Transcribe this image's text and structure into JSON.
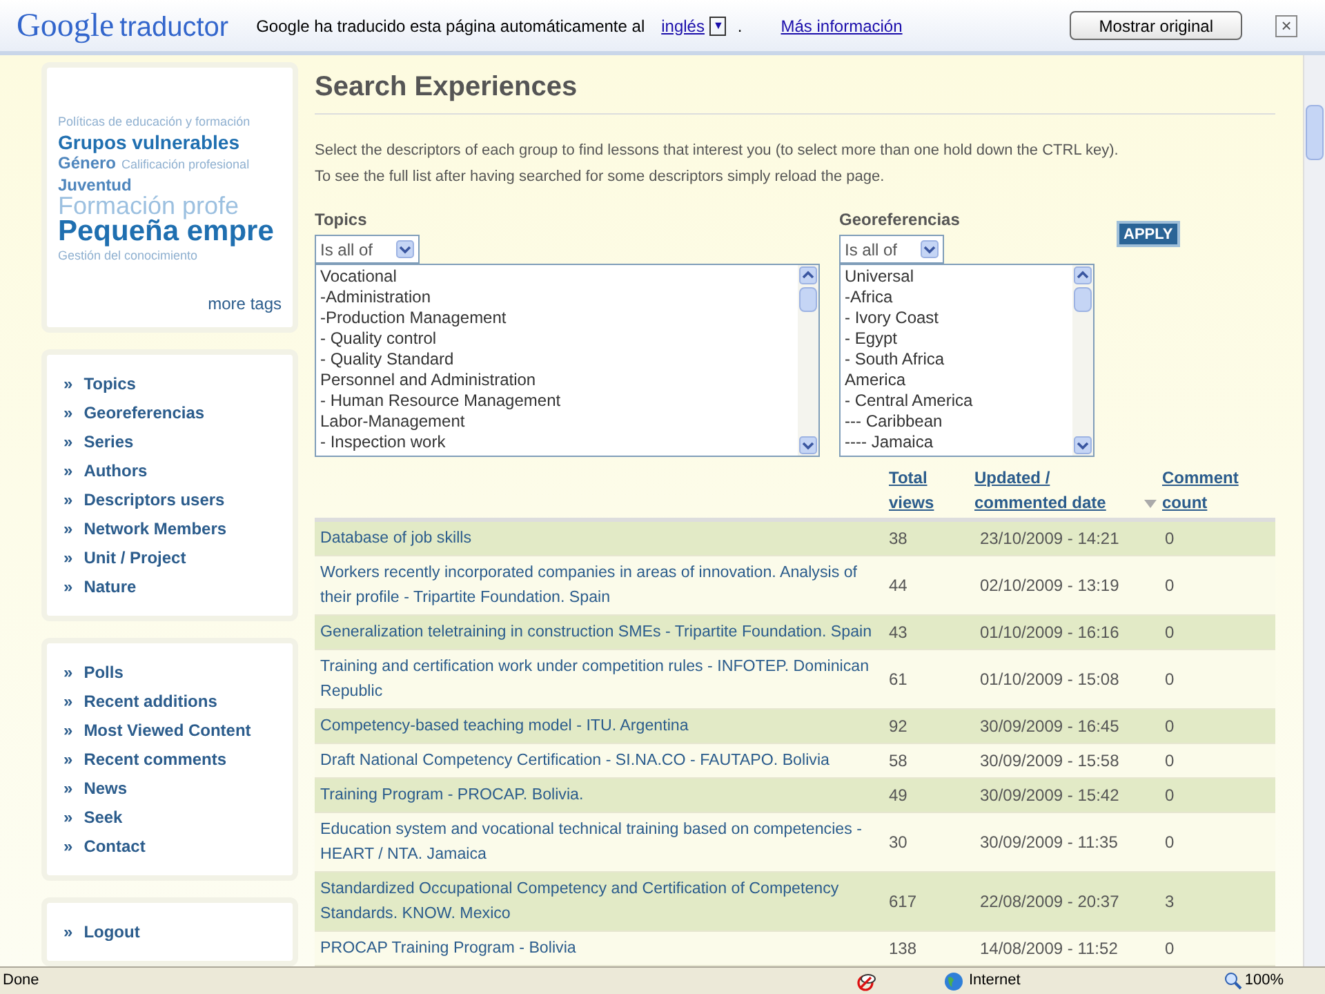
{
  "translate_bar": {
    "logo_brand": "Google",
    "logo_product": "traductor",
    "message": "Google ha traducido esta página automáticamente al",
    "language": "inglés",
    "dropdown_glyph": "▼",
    "separator": ".",
    "more_info": "Más información",
    "show_original": "Mostrar original",
    "close": "×"
  },
  "tag_cloud": {
    "tags": [
      {
        "label": "Políticas de educación y formación",
        "kind": "small"
      },
      {
        "label": "Grupos vulnerables",
        "kind": "large"
      },
      {
        "label": "Género",
        "kind": "medium"
      },
      {
        "label": "Calificación profesional",
        "kind": "small"
      },
      {
        "label": "Juventud",
        "kind": "medium"
      },
      {
        "label": "Formación profe",
        "kind": "xlarge"
      },
      {
        "label": "Pequeña empre",
        "kind": "xxlarge"
      },
      {
        "label": "Gestión del conocimiento",
        "kind": "small"
      }
    ],
    "more": "more tags"
  },
  "menu_1": [
    {
      "bullet": "»",
      "label": "Topics"
    },
    {
      "bullet": "»",
      "label": "Georeferencias"
    },
    {
      "bullet": "»",
      "label": "Series"
    },
    {
      "bullet": "»",
      "label": "Authors"
    },
    {
      "bullet": "»",
      "label": "Descriptors users"
    },
    {
      "bullet": "»",
      "label": "Network Members"
    },
    {
      "bullet": "»",
      "label": "Unit / Project"
    },
    {
      "bullet": "»",
      "label": "Nature"
    }
  ],
  "menu_2": [
    {
      "bullet": "»",
      "label": "Polls"
    },
    {
      "bullet": "»",
      "label": "Recent additions"
    },
    {
      "bullet": "»",
      "label": "Most Viewed Content"
    },
    {
      "bullet": "»",
      "label": "Recent comments"
    },
    {
      "bullet": "»",
      "label": "News"
    },
    {
      "bullet": "»",
      "label": "Seek"
    },
    {
      "bullet": "»",
      "label": "Contact"
    }
  ],
  "menu_3": [
    {
      "bullet": "»",
      "label": "Logout"
    }
  ],
  "page_title": "Search Experiences",
  "instructions": [
    "Select the descriptors of each group to find lessons that interest you (to select more than one hold down the CTRL key).",
    "To see the full list after having searched for some descriptors simply reload the page."
  ],
  "filters": [
    {
      "label": "Topics",
      "operator": "Is all of",
      "options": [
        "Vocational",
        "-Administration",
        "-Production Management",
        "- Quality control",
        "- Quality Standard",
        "Personnel and Administration",
        "- Human Resource Management",
        "Labor-Management",
        "- Inspection work"
      ]
    },
    {
      "label": "Georeferencias",
      "operator": "Is all of",
      "options": [
        "Universal",
        "-Africa",
        "- Ivory Coast",
        "- Egypt",
        "- South Africa",
        "America",
        "- Central America",
        "--- Caribbean",
        "---- Jamaica"
      ]
    }
  ],
  "apply": "APPLY",
  "table": {
    "columns": [
      {
        "label": "Total views"
      },
      {
        "label": "Updated / commented date",
        "sorted": true
      },
      {
        "label": "Comment count"
      }
    ],
    "rows": [
      {
        "title": "Database of job skills",
        "views": "38",
        "date": "23/10/2009 - 14:21",
        "comments": "0"
      },
      {
        "title": "Workers recently incorporated companies in areas of innovation. Analysis of their profile - Tripartite Foundation. Spain",
        "views": "44",
        "date": "02/10/2009 - 13:19",
        "comments": "0"
      },
      {
        "title": "Generalization teletraining in construction SMEs - Tripartite Foundation. Spain",
        "views": "43",
        "date": "01/10/2009 - 16:16",
        "comments": "0"
      },
      {
        "title": "Training and certification work under competition rules - INFOTEP. Dominican Republic",
        "views": "61",
        "date": "01/10/2009 - 15:08",
        "comments": "0"
      },
      {
        "title": "Competency-based teaching model - ITU. Argentina",
        "views": "92",
        "date": "30/09/2009 - 16:45",
        "comments": "0"
      },
      {
        "title": "Draft National Competency Certification - SI.NA.CO - FAUTAPO. Bolivia",
        "views": "58",
        "date": "30/09/2009 - 15:58",
        "comments": "0"
      },
      {
        "title": "Training Program - PROCAP. Bolivia.",
        "views": "49",
        "date": "30/09/2009 - 15:42",
        "comments": "0"
      },
      {
        "title": "Education system and vocational technical training based on competencies - HEART / NTA. Jamaica",
        "views": "30",
        "date": "30/09/2009 - 11:35",
        "comments": "0"
      },
      {
        "title": "Standardized Occupational Competency and Certification of Competency Standards. KNOW. Mexico",
        "views": "617",
        "date": "22/08/2009 - 20:37",
        "comments": "3"
      },
      {
        "title": "PROCAP Training Program - Bolivia",
        "views": "138",
        "date": "14/08/2009 - 11:52",
        "comments": "0"
      }
    ]
  },
  "status_bar": {
    "status": "Done",
    "zone": "Internet",
    "zoom": "100%"
  }
}
